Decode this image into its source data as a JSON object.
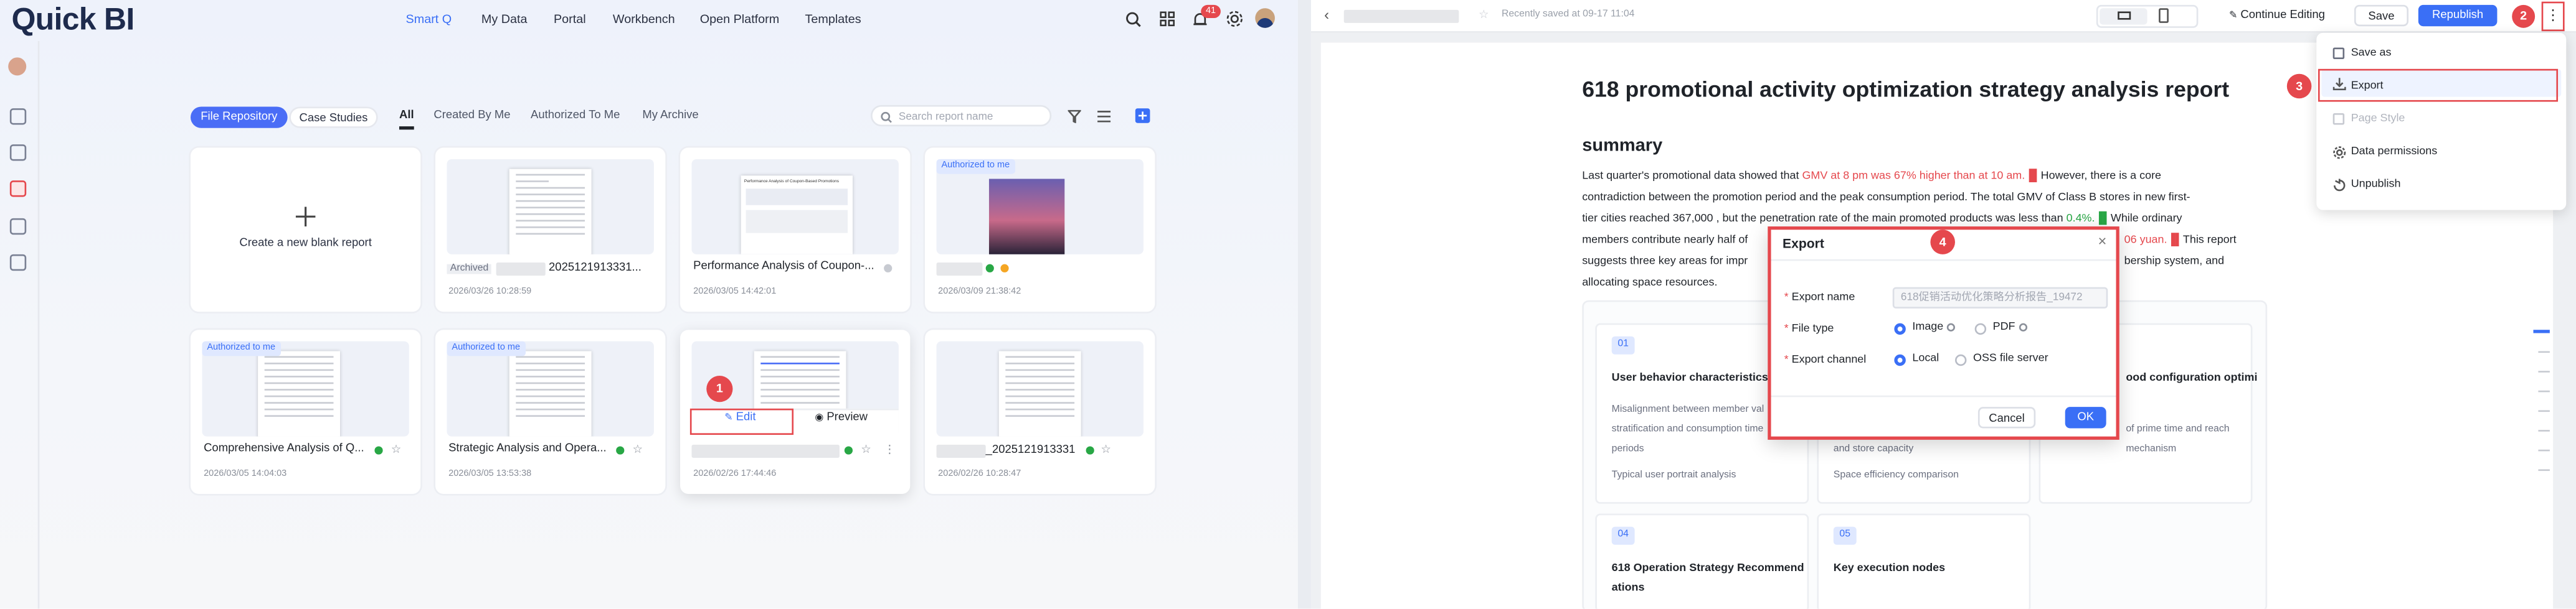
{
  "left": {
    "logo": "Quick BI",
    "nav": [
      "Smart Q",
      "My Data",
      "Portal",
      "Workbench",
      "Open Platform",
      "Templates"
    ],
    "notification_count": "41",
    "repo_tabs": {
      "file_repository": "File Repository",
      "case_studies": "Case Studies"
    },
    "filter_tabs": [
      "All",
      "Created By Me",
      "Authorized To Me",
      "My Archive"
    ],
    "search_placeholder": "Search report name",
    "create_blank": "Create a new blank report",
    "cards": [
      {
        "title": "Archived",
        "title2": "2025121913331...",
        "date": "2026/03/26 10:28:59"
      },
      {
        "title": "Performance Analysis of Coupon-...",
        "date": "2026/03/05 14:42:01"
      },
      {
        "badge": "Authorized to me",
        "date": "2026/03/09 21:38:42"
      },
      {
        "badge": "Authorized to me",
        "title": "Comprehensive Analysis of Q...",
        "date": "2026/03/05 14:04:03"
      },
      {
        "badge": "Authorized to me",
        "title": "Strategic Analysis and Opera...",
        "date": "2026/03/05 13:53:38"
      },
      {
        "edit": "Edit",
        "preview": "Preview",
        "date": "2026/02/26 17:44:46"
      },
      {
        "title": "_2025121913331",
        "date": "2026/02/26 10:28:47"
      }
    ],
    "thumb_doc_title": "Performance Analysis of Coupon-Based Promotions"
  },
  "right": {
    "saved_text": "Recently saved at 09-17 11:04",
    "continue_editing": "Continue Editing",
    "save": "Save",
    "republish": "Republish",
    "menu": [
      "Save as",
      "Export",
      "Page Style",
      "Data permissions",
      "Unpublish"
    ],
    "report_title": "618 promotional activity optimization strategy analysis report",
    "summary_heading": "summary",
    "summary": {
      "l1a": "Last quarter's promotional data showed that ",
      "l1b": "GMV at 8 pm was 67% higher than at 10 am.",
      "l1c": "However, there is a core",
      "l2": "contradiction between the promotion period and the peak consumption period. The total GMV of Class B stores in new first-",
      "l3a": "tier cities reached 367,000 , but the penetration rate of the main promoted products was less than ",
      "l3b": "0.4%.",
      "l3c": "While ordinary",
      "l4a": "members contribute nearly half of",
      "l4b": "06 yuan.",
      "l4c": "This report",
      "l5a": "suggests three key areas for impr",
      "l5b": "bership system, and",
      "l6": "allocating space resources."
    },
    "sections": [
      {
        "num": "01",
        "title": "User behavior characteristics in",
        "desc1": "Misalignment between member val",
        "desc2": "stratification and consumption time",
        "desc3": "periods",
        "foot": "Typical user portrait analysis"
      },
      {
        "num": "",
        "title": "",
        "desc1": "and store capacity",
        "foot": "Space efficiency comparison"
      },
      {
        "num": "",
        "title": "ood configuration optimi",
        "desc1": "of prime time and reach",
        "desc2": "mechanism"
      },
      {
        "num": "04",
        "title": "618 Operation Strategy Recommend",
        "title2": "ations"
      },
      {
        "num": "05",
        "title": "Key execution nodes"
      }
    ],
    "export_dialog": {
      "title": "Export",
      "name_label": "Export name",
      "name_value": "618促销活动优化策略分析报告_19472",
      "filetype_label": "File type",
      "filetype_options": [
        "Image",
        "PDF"
      ],
      "channel_label": "Export channel",
      "channel_options": [
        "Local",
        "OSS file server"
      ],
      "cancel": "Cancel",
      "ok": "OK"
    }
  },
  "steps": [
    "1",
    "2",
    "3",
    "4"
  ],
  "colors": {
    "accent": "#3a6ff6",
    "highlight": "#e5484d",
    "ok_green": "#28a745"
  }
}
